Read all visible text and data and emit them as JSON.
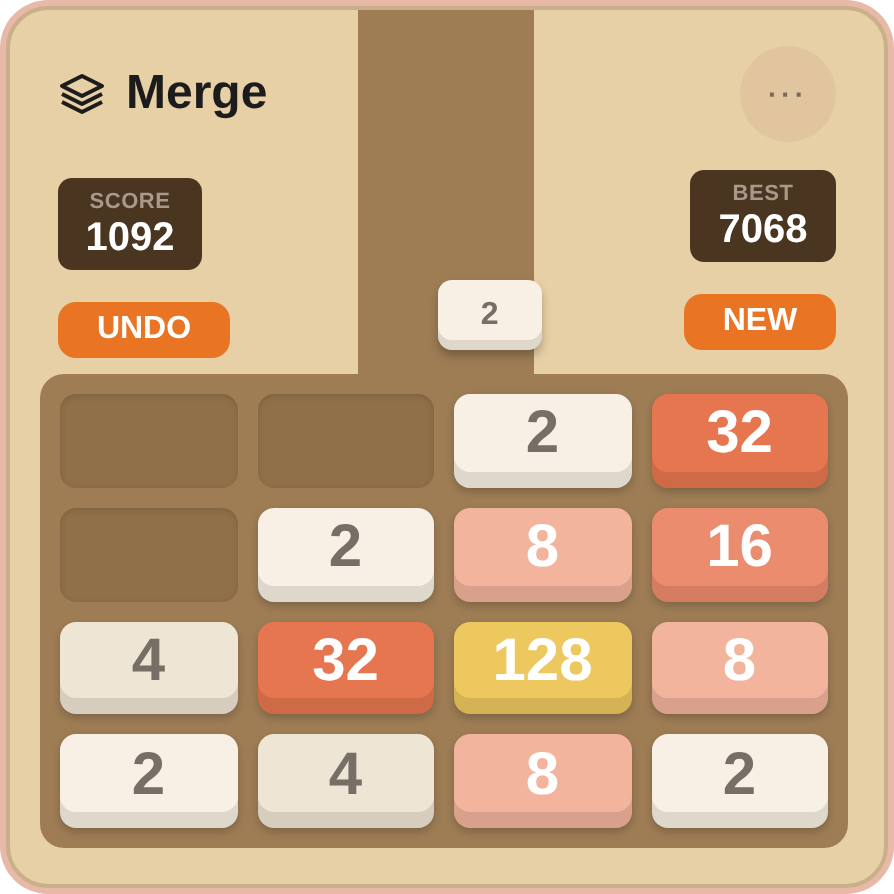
{
  "title": "Merge",
  "menu_button": "···",
  "score": {
    "label": "SCORE",
    "value": "1092"
  },
  "best": {
    "label": "BEST",
    "value": "7068"
  },
  "buttons": [
    "UNDO",
    "NEW"
  ],
  "next_tile": {
    "value": "2",
    "color": "#f8f0e4",
    "kind": "light"
  },
  "board": [
    {
      "kind": "empty"
    },
    {
      "kind": "empty"
    },
    {
      "kind": "light",
      "value": "2",
      "color": "#f8f0e4"
    },
    {
      "kind": "bright",
      "value": "32",
      "color": "#e6764f"
    },
    {
      "kind": "empty"
    },
    {
      "kind": "light",
      "value": "2",
      "color": "#f8f0e4"
    },
    {
      "kind": "bright",
      "value": "8",
      "color": "#f2b49c"
    },
    {
      "kind": "bright",
      "value": "16",
      "color": "#ec8c6e"
    },
    {
      "kind": "light",
      "value": "4",
      "color": "#efe5d5"
    },
    {
      "kind": "bright",
      "value": "32",
      "color": "#e6764f"
    },
    {
      "kind": "bright",
      "value": "128",
      "color": "#ecc85e"
    },
    {
      "kind": "bright",
      "value": "8",
      "color": "#f2b49c"
    },
    {
      "kind": "light",
      "value": "2",
      "color": "#f8f0e4"
    },
    {
      "kind": "light",
      "value": "4",
      "color": "#efe5d5"
    },
    {
      "kind": "bright",
      "value": "8",
      "color": "#f2b49c"
    },
    {
      "kind": "light",
      "value": "2",
      "color": "#f8f0e4"
    }
  ]
}
